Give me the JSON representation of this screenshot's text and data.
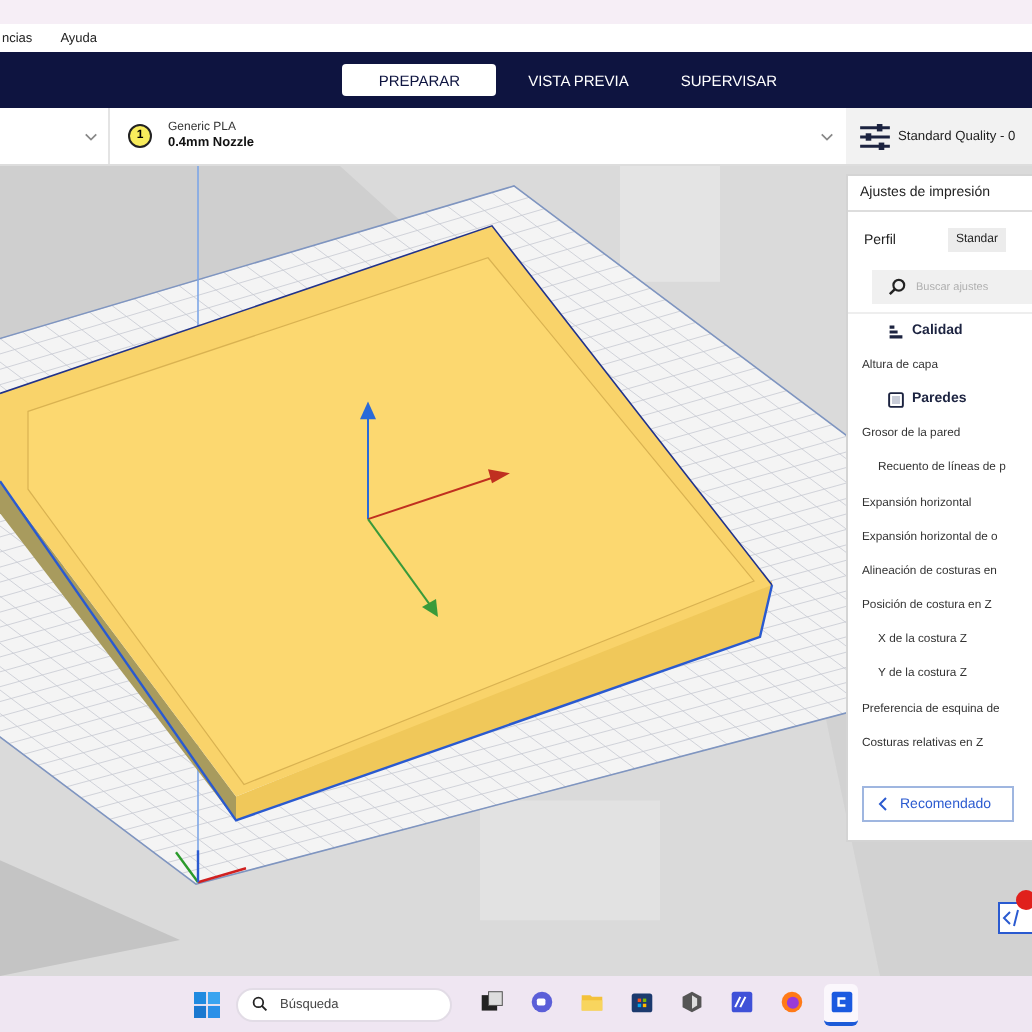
{
  "menu_bar": {
    "items": [
      "ncias",
      "Ayuda"
    ]
  },
  "stage_tabs": [
    {
      "label": "PREPARAR",
      "selected": true
    },
    {
      "label": "VISTA PREVIA",
      "selected": false
    },
    {
      "label": "SUPERVISAR",
      "selected": false
    }
  ],
  "toolbar": {
    "extruder_number": "1",
    "material": "Generic PLA",
    "nozzle": "0.4mm Nozzle",
    "profile": "Standard Quality - 0"
  },
  "print_settings": {
    "title": "Ajustes de impresión",
    "profile_label": "Perfil",
    "profile_value": "Standar",
    "search": {
      "placeholder": "Buscar ajustes"
    },
    "items": [
      {
        "kind": "category",
        "label": "Calidad"
      },
      {
        "kind": "setting",
        "label": "Altura de capa"
      },
      {
        "kind": "category",
        "label": "Paredes"
      },
      {
        "kind": "setting",
        "label": "Grosor de la pared",
        "children": [
          {
            "kind": "setting",
            "label": "Recuento de líneas de p"
          }
        ]
      },
      {
        "kind": "setting",
        "label": "Expansión horizontal"
      },
      {
        "kind": "setting",
        "label": "Expansión horizontal de o"
      },
      {
        "kind": "setting",
        "label": "Alineación de costuras en"
      },
      {
        "kind": "setting",
        "label": "Posición de costura en Z",
        "children": [
          {
            "kind": "setting",
            "label": "X de la costura Z"
          },
          {
            "kind": "setting",
            "label": "Y de la costura Z"
          }
        ]
      },
      {
        "kind": "setting",
        "label": "Preferencia de esquina de"
      },
      {
        "kind": "setting",
        "label": "Costuras relativas en Z"
      }
    ],
    "back_button": "Recomendado"
  },
  "taskbar": {
    "search": {
      "placeholder": "Búsqueda"
    },
    "apps": [
      {
        "kind": "window",
        "selected": false
      },
      {
        "kind": "chat",
        "selected": false
      },
      {
        "kind": "folder",
        "selected": false
      },
      {
        "kind": "store",
        "selected": false
      },
      {
        "kind": "hex",
        "selected": false
      },
      {
        "kind": "editor",
        "selected": false
      },
      {
        "kind": "browser",
        "selected": false
      },
      {
        "kind": "slicer",
        "selected": true
      }
    ]
  }
}
